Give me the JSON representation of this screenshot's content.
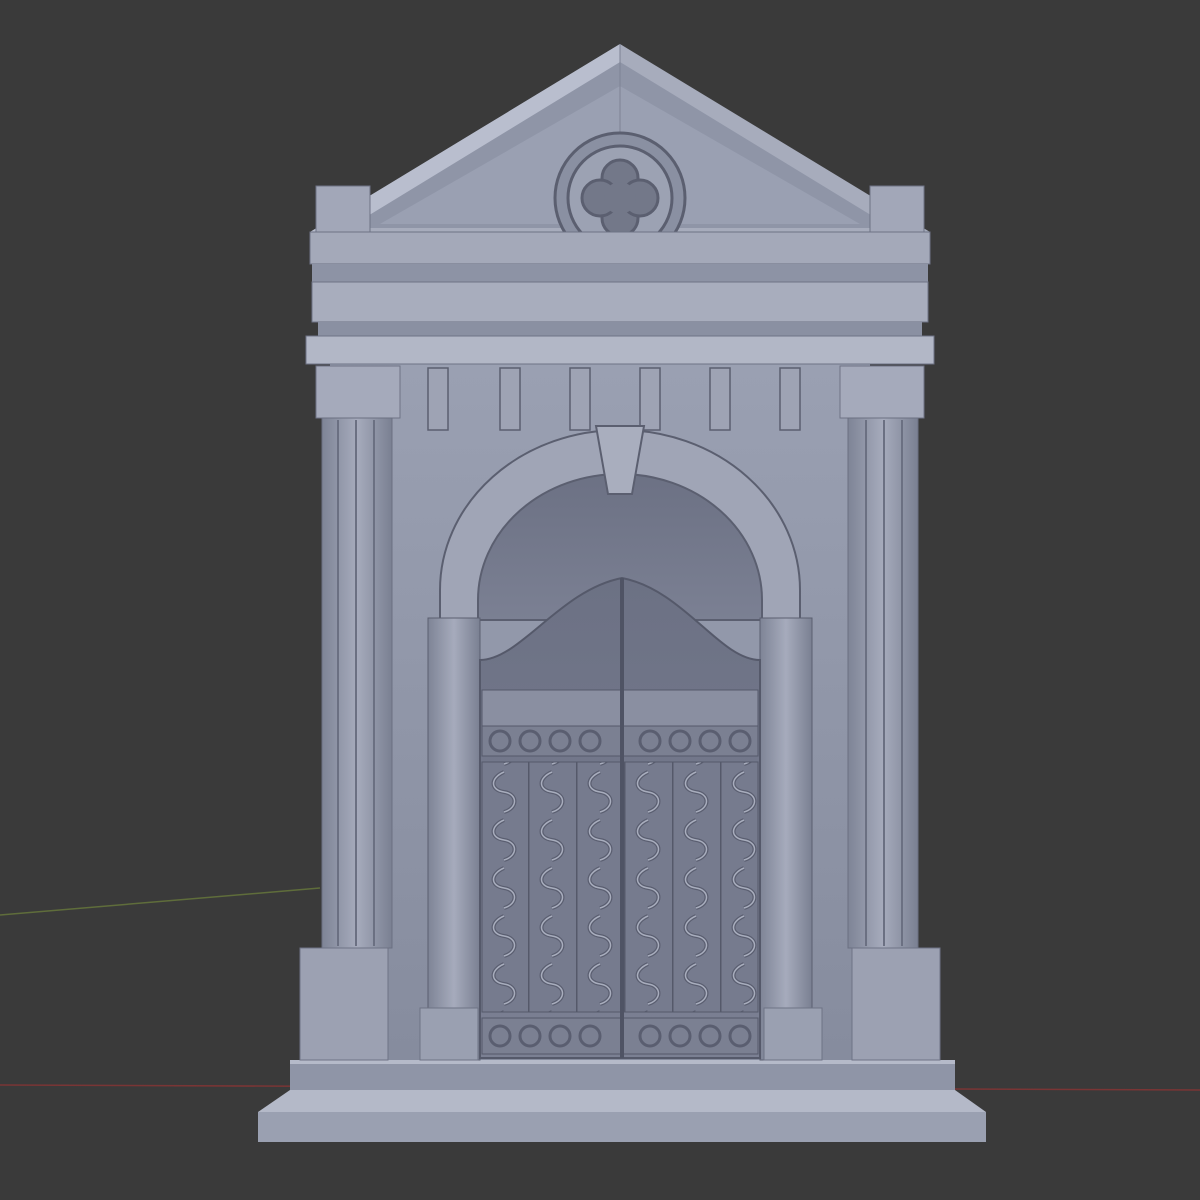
{
  "viewport": {
    "background": "#3a3a3a",
    "grid_floor_line_color": "#7a2f2f",
    "grid_axis_line_color": "#5b6a3a"
  },
  "model": {
    "subject": "mausoleum-facade",
    "material_color": "#8e94a6",
    "shadow_color": "#5d6172",
    "highlight_color": "#b9bece",
    "features": {
      "pediment_ornament": "quatrefoil-rosette",
      "dentil_brackets": 6,
      "keystone": true,
      "pilasters": 2,
      "gate_leaves": 2
    }
  }
}
